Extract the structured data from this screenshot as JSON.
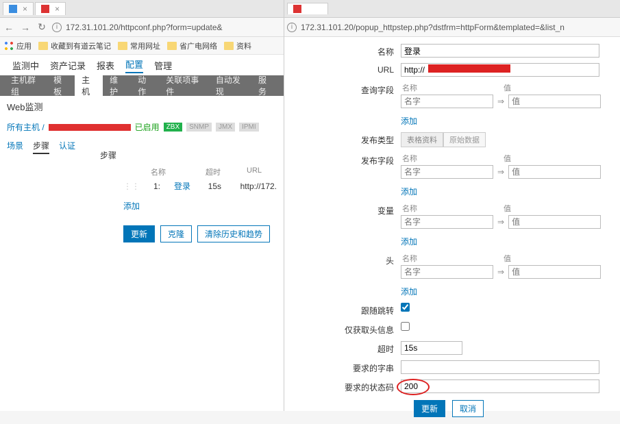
{
  "left": {
    "tabs": [
      {
        "icon_color": "#3b8ee0"
      },
      {
        "icon_color": "#d33"
      }
    ],
    "url": "172.31.101.20/httpconf.php?form=update&",
    "bookmarks": {
      "apps": "应用",
      "items": [
        "收藏到有道云笔记",
        "常用网址",
        "省广电网络",
        "资料"
      ]
    },
    "mainnav": [
      "监测中",
      "资产记录",
      "报表",
      "配置",
      "管理"
    ],
    "mainnav_active": "配置",
    "subnav": [
      "主机群组",
      "模板",
      "主机",
      "维护",
      "动作",
      "关联项事件",
      "自动发现",
      "服务"
    ],
    "subnav_active": "主机",
    "section_title": "Web监测",
    "path_label": "所有主机 /",
    "enabled": "已启用",
    "badges": [
      "ZBX",
      "SNMP",
      "JMX",
      "IPMI"
    ],
    "tabs2": [
      "场景",
      "步骤",
      "认证"
    ],
    "tabs2_active": "步骤",
    "steps_label": "步骤",
    "table": {
      "headers": [
        "名称",
        "超时",
        "URL"
      ],
      "row": {
        "idx": "1:",
        "name": "登录",
        "timeout": "15s",
        "url": "http://172."
      }
    },
    "add": "添加",
    "buttons": [
      "更新",
      "克隆",
      "清除历史和趋势"
    ]
  },
  "right": {
    "url": "172.31.101.20/popup_httpstep.php?dstfrm=httpForm&templated=&list_n",
    "labels": {
      "name": "名称",
      "url": "URL",
      "query": "查询字段",
      "pub_type": "发布类型",
      "pub_field": "发布字段",
      "vars": "变量",
      "headers": "头",
      "follow": "跟随跳转",
      "head_only": "仅获取头信息",
      "timeout": "超时",
      "req_str": "要求的字串",
      "req_code": "要求的状态码"
    },
    "values": {
      "name": "登录",
      "url": "http://",
      "timeout": "15s",
      "req_code": "200"
    },
    "pair_headers": {
      "name": "名称",
      "value": "值"
    },
    "pair_placeholder": {
      "name": "名字",
      "value": "值"
    },
    "add": "添加",
    "pub_types": [
      "表格资料",
      "原始数据"
    ],
    "follow_checked": true,
    "head_only_checked": false,
    "buttons": {
      "update": "更新",
      "cancel": "取消"
    }
  }
}
